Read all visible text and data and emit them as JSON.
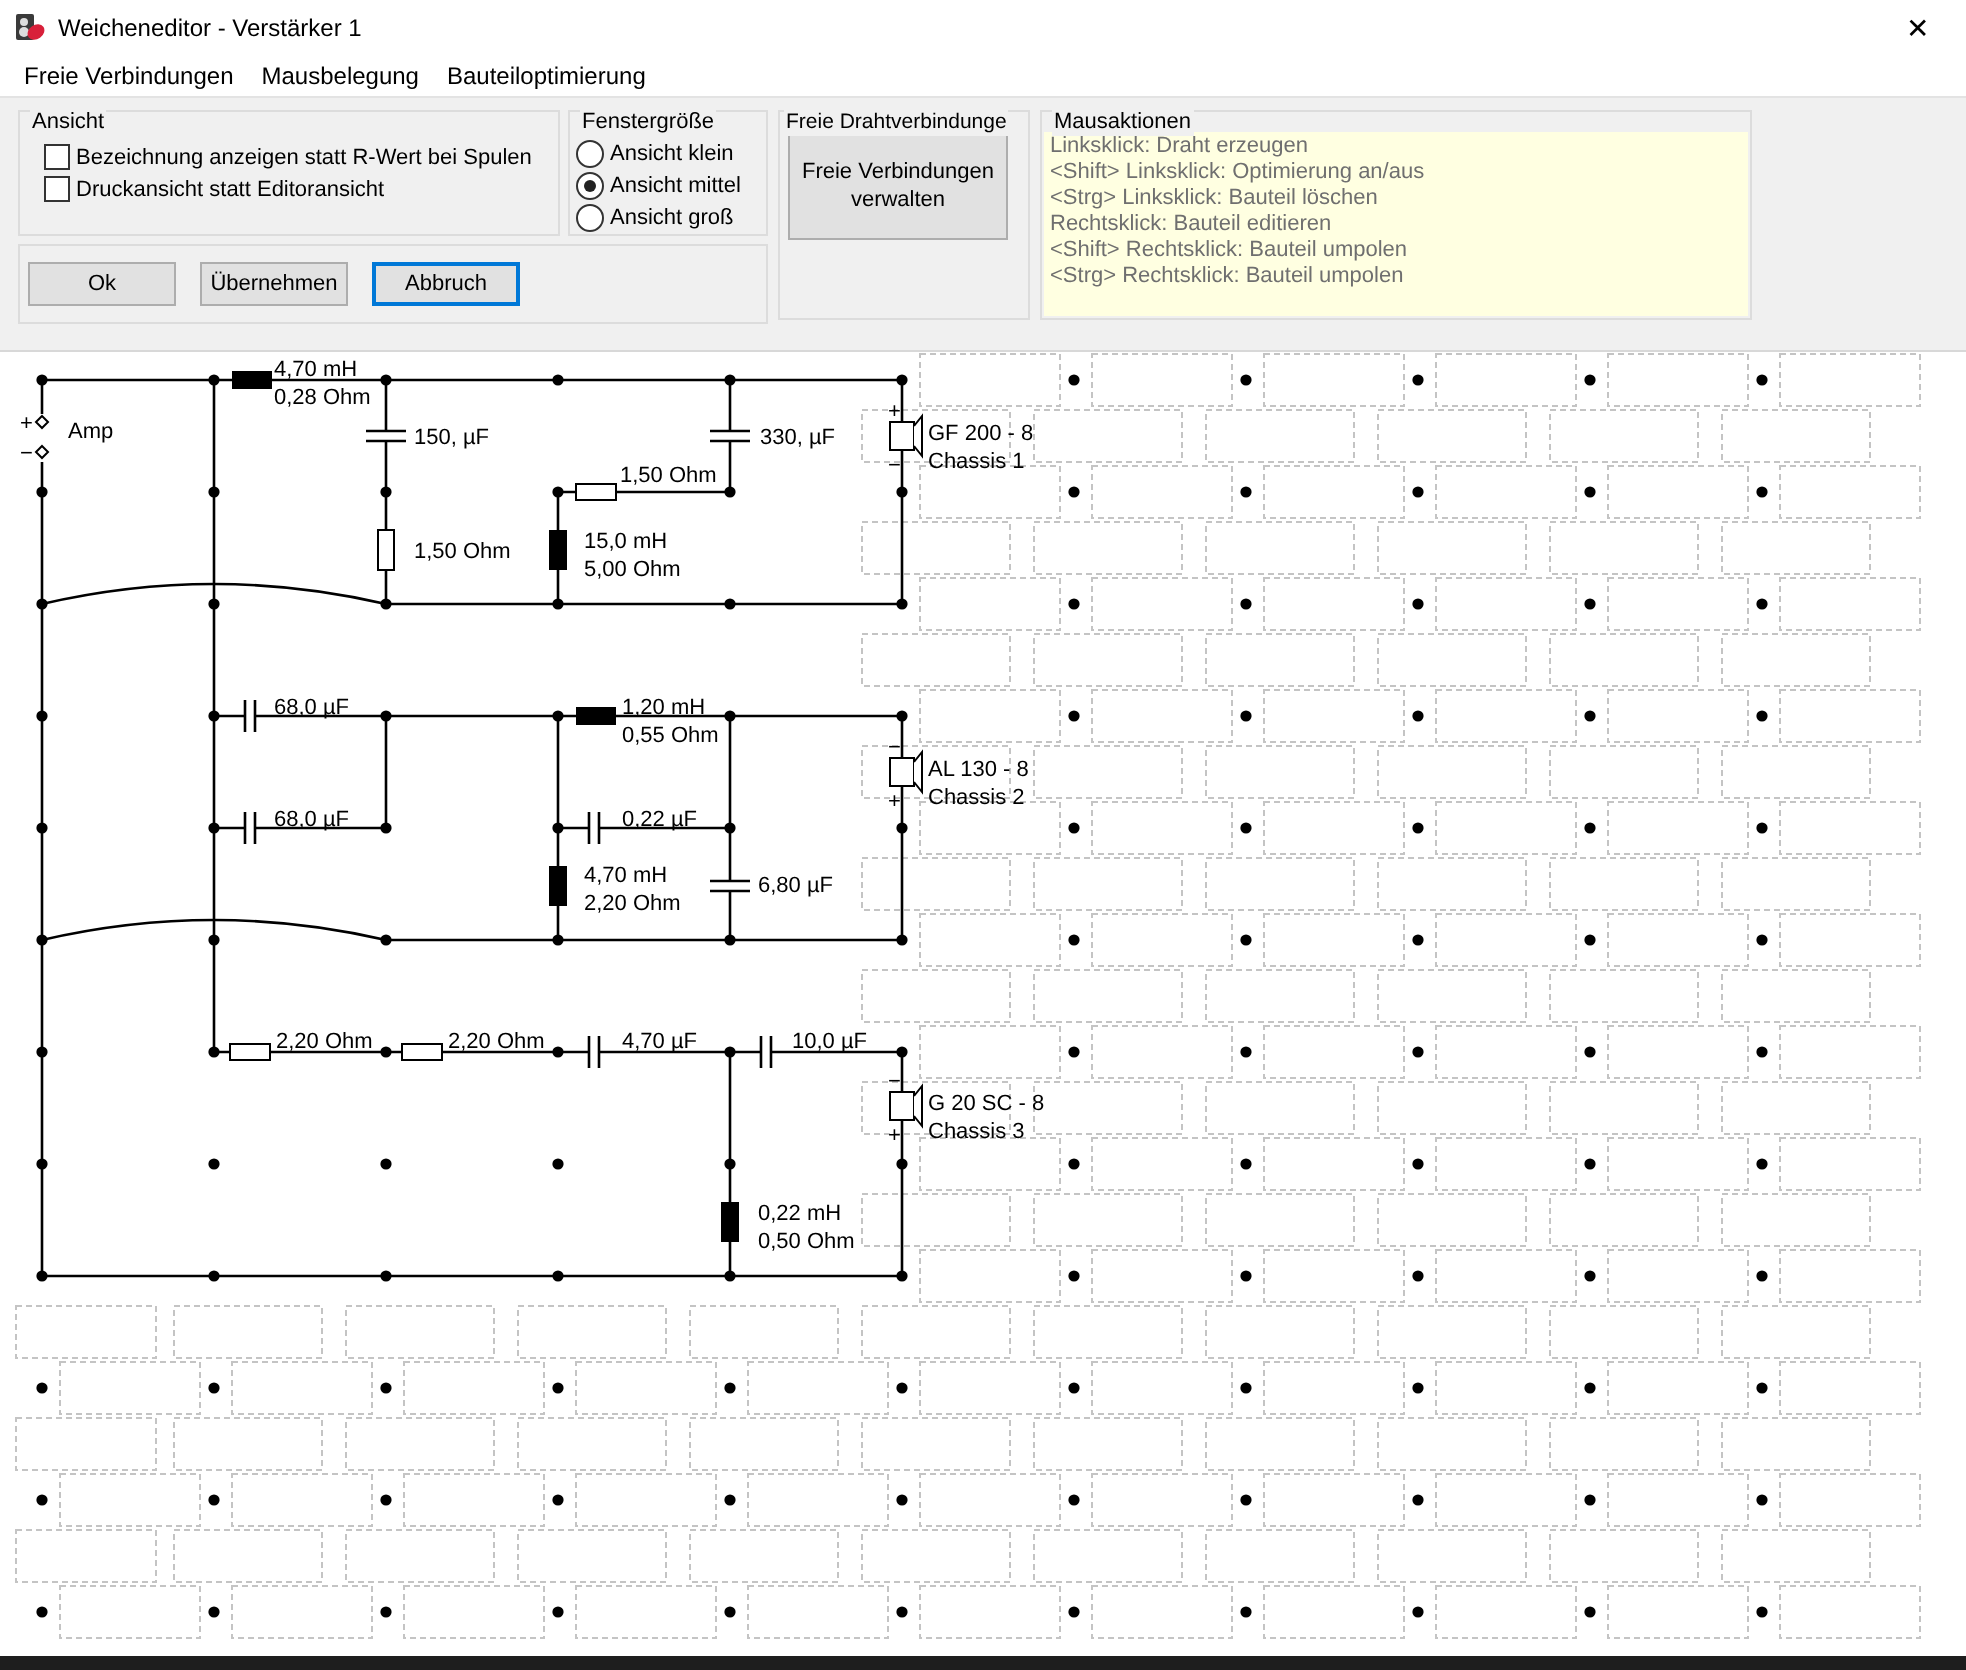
{
  "window": {
    "title": "Weicheneditor - Verstärker 1",
    "close": "✕"
  },
  "menu": [
    "Freie Verbindungen",
    "Mausbelegung",
    "Bauteiloptimierung"
  ],
  "ansicht": {
    "title": "Ansicht",
    "checkboxes": [
      {
        "label": "Bezeichnung anzeigen statt R-Wert bei Spulen",
        "checked": false
      },
      {
        "label": "Druckansicht statt Editoransicht",
        "checked": false
      }
    ]
  },
  "fenstergroesse": {
    "title": "Fenstergröße",
    "options": [
      {
        "label": "Ansicht klein",
        "selected": false
      },
      {
        "label": "Ansicht mittel",
        "selected": true
      },
      {
        "label": "Ansicht groß",
        "selected": false
      }
    ]
  },
  "buttons": [
    {
      "label": "Ok",
      "focused": false
    },
    {
      "label": "Übernehmen",
      "focused": false
    },
    {
      "label": "Abbruch",
      "focused": true
    }
  ],
  "draht": {
    "title": "Freie Drahtverbindunge",
    "button": "Freie Verbindungen verwalten"
  },
  "mausaktionen": {
    "title": "Mausaktionen",
    "lines": [
      "Linksklick: Draht erzeugen",
      "<Shift> Linksklick: Optimierung an/aus",
      "<Strg> Linksklick: Bauteil löschen",
      "Rechtsklick: Bauteil editieren",
      "<Shift> Rechtsklick: Bauteil umpolen",
      "<Strg> Rechtsklick: Bauteil umpolen"
    ]
  },
  "schematic": {
    "components": [
      {
        "kind": "source",
        "lines": [
          "Amp"
        ],
        "plus": "+",
        "minus": "−"
      },
      {
        "kind": "inductor",
        "lines": [
          "4,70 mH",
          "0,28 Ohm"
        ]
      },
      {
        "kind": "capacitor",
        "lines": [
          "150, µF"
        ]
      },
      {
        "kind": "resistor",
        "lines": [
          "1,50 Ohm"
        ]
      },
      {
        "kind": "capacitor",
        "lines": [
          "330, µF"
        ]
      },
      {
        "kind": "resistor",
        "lines": [
          "1,50 Ohm"
        ]
      },
      {
        "kind": "inductor",
        "lines": [
          "15,0 mH",
          "5,00 Ohm"
        ]
      },
      {
        "kind": "speaker",
        "lines": [
          "GF 200 - 8",
          "Chassis 1"
        ],
        "inverted": false,
        "plus": "+",
        "minus": "−"
      },
      {
        "kind": "capacitor",
        "lines": [
          "68,0 µF"
        ]
      },
      {
        "kind": "capacitor",
        "lines": [
          "68,0 µF"
        ]
      },
      {
        "kind": "inductor",
        "lines": [
          "1,20 mH",
          "0,55 Ohm"
        ]
      },
      {
        "kind": "capacitor",
        "lines": [
          "0,22 µF"
        ]
      },
      {
        "kind": "inductor",
        "lines": [
          "4,70 mH",
          "2,20 Ohm"
        ]
      },
      {
        "kind": "capacitor",
        "lines": [
          "6,80 µF"
        ]
      },
      {
        "kind": "speaker",
        "lines": [
          "AL 130 - 8",
          "Chassis 2"
        ],
        "inverted": true,
        "plus": "+",
        "minus": "−"
      },
      {
        "kind": "resistor",
        "lines": [
          "2,20 Ohm"
        ]
      },
      {
        "kind": "resistor",
        "lines": [
          "2,20 Ohm"
        ]
      },
      {
        "kind": "capacitor",
        "lines": [
          "4,70 µF"
        ]
      },
      {
        "kind": "capacitor",
        "lines": [
          "10,0 µF"
        ]
      },
      {
        "kind": "inductor",
        "lines": [
          "0,22 mH",
          "0,50 Ohm"
        ]
      },
      {
        "kind": "speaker",
        "lines": [
          "G 20 SC - 8",
          "Chassis 3"
        ],
        "inverted": true,
        "plus": "+",
        "minus": "−"
      }
    ]
  }
}
